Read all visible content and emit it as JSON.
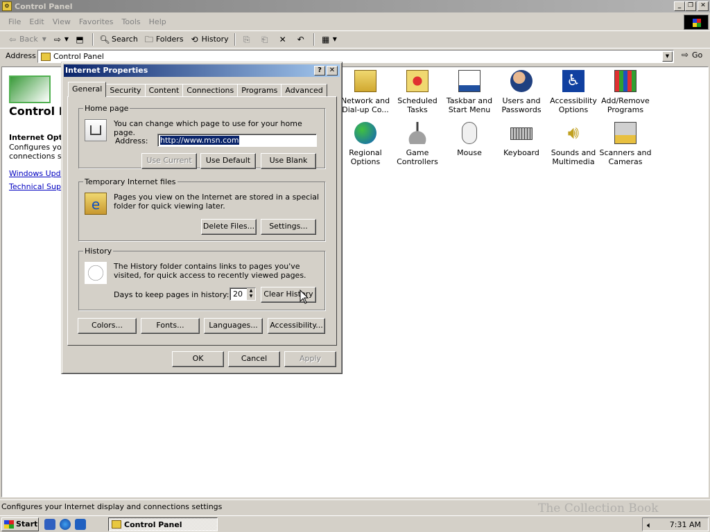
{
  "window": {
    "title": "Control Panel"
  },
  "menu": [
    "File",
    "Edit",
    "View",
    "Favorites",
    "Tools",
    "Help"
  ],
  "toolbar": {
    "back": "Back",
    "search": "Search",
    "folders": "Folders",
    "history": "History"
  },
  "address": {
    "label": "Address",
    "value": "Control Panel",
    "go": "Go"
  },
  "left": {
    "title": "Control Panel",
    "section_title": "Internet Options",
    "section_text": "Configures your Internet display and connections settings.",
    "links": [
      "Windows Update",
      "Technical Support"
    ]
  },
  "icons": [
    {
      "label": "Network and Dial-up Co...",
      "icon": "network-icon"
    },
    {
      "label": "Scheduled Tasks",
      "icon": "scheduled-tasks-icon"
    },
    {
      "label": "Taskbar and Start Menu",
      "icon": "taskbar-icon"
    },
    {
      "label": "Users and Passwords",
      "icon": "users-icon"
    },
    {
      "label": "Accessibility Options",
      "icon": "accessibility-icon"
    },
    {
      "label": "Add/Remove Programs",
      "icon": "add-remove-icon"
    },
    {
      "label": "Regional Options",
      "icon": "globe-icon"
    },
    {
      "label": "Game Controllers",
      "icon": "joystick-icon"
    },
    {
      "label": "Mouse",
      "icon": "mouse-icon"
    },
    {
      "label": "Keyboard",
      "icon": "keyboard-icon"
    },
    {
      "label": "Sounds and Multimedia",
      "icon": "speaker-icon"
    },
    {
      "label": "Scanners and Cameras",
      "icon": "scanner-icon"
    }
  ],
  "status": "Configures your Internet display and connections settings",
  "taskbar": {
    "start": "Start",
    "task": "Control Panel",
    "clock": "7:31 AM"
  },
  "watermark": "The Collection Book",
  "dialog": {
    "title": "Internet Properties",
    "tabs": [
      "General",
      "Security",
      "Content",
      "Connections",
      "Programs",
      "Advanced"
    ],
    "home": {
      "legend": "Home page",
      "text": "You can change which page to use for your home page.",
      "address_label": "Address:",
      "address_value": "http://www.msn.com",
      "use_current": "Use Current",
      "use_default": "Use Default",
      "use_blank": "Use Blank"
    },
    "temp": {
      "legend": "Temporary Internet files",
      "text": "Pages you view on the Internet are stored in a special folder for quick viewing later.",
      "delete": "Delete Files...",
      "settings": "Settings..."
    },
    "history": {
      "legend": "History",
      "text": "The History folder contains links to pages you've visited, for quick access to recently viewed pages.",
      "days_label": "Days to keep pages in history:",
      "days": "20",
      "clear": "Clear History"
    },
    "bottom": {
      "colors": "Colors...",
      "fonts": "Fonts...",
      "languages": "Languages...",
      "accessibility": "Accessibility..."
    },
    "ok": "OK",
    "cancel": "Cancel",
    "apply": "Apply"
  }
}
